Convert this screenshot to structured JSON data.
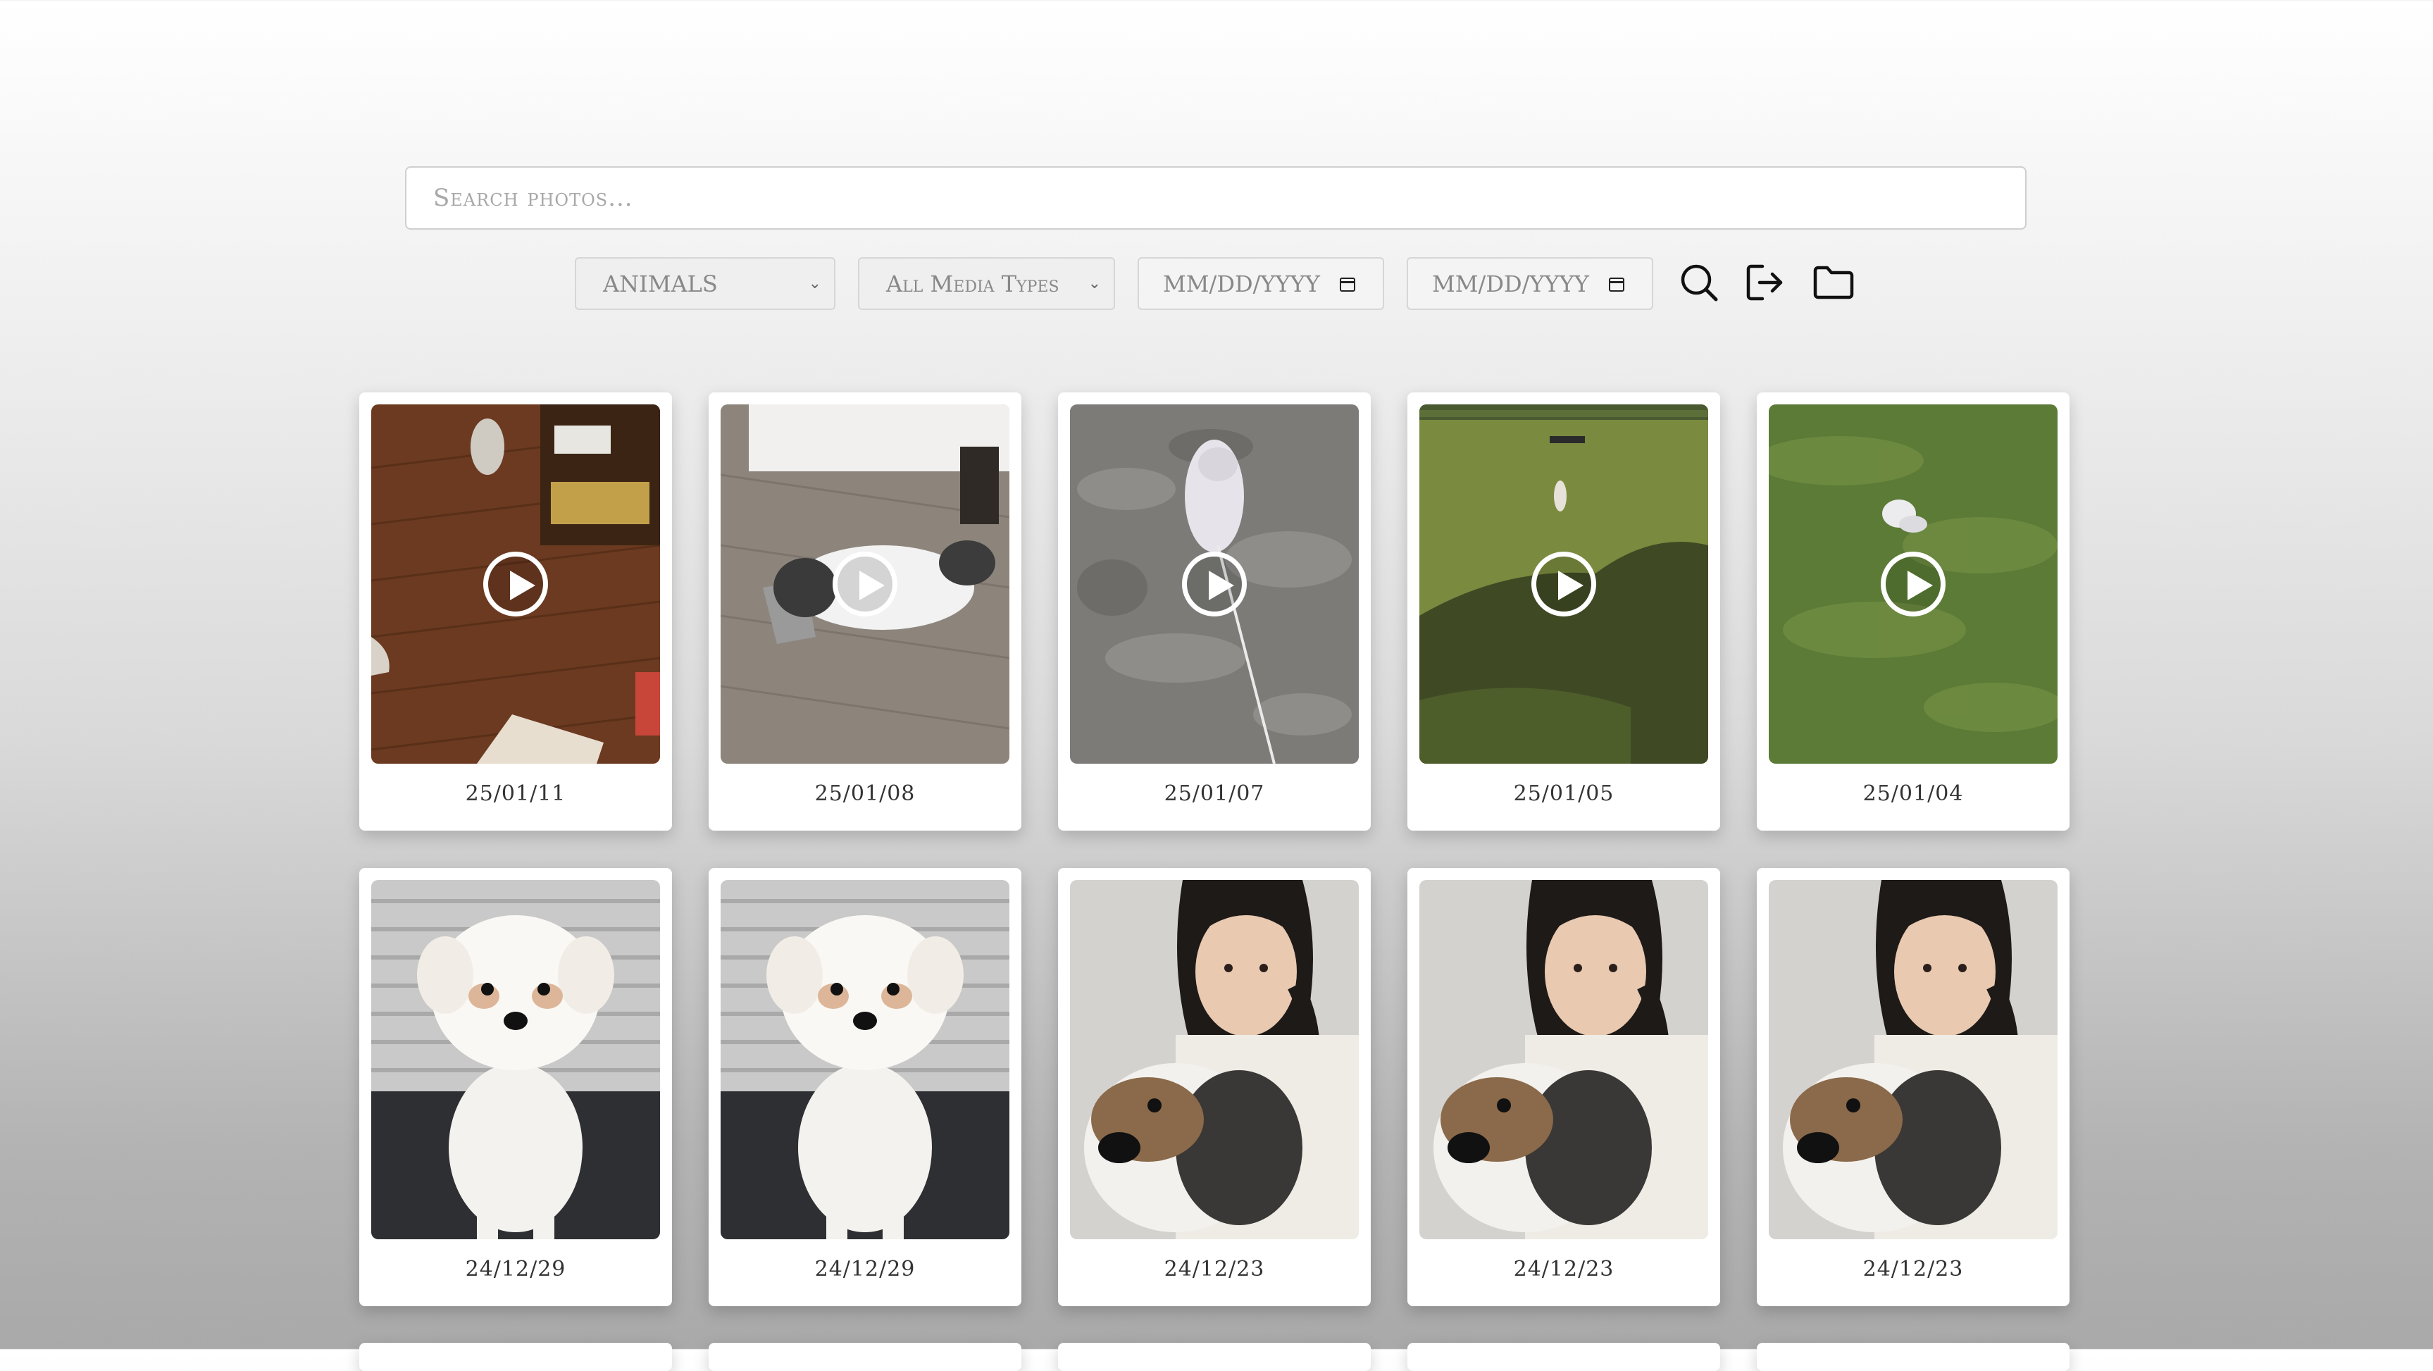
{
  "search": {
    "placeholder": "Search photos..."
  },
  "filters": {
    "category": "ANIMALS",
    "media_type": "All Media Types",
    "start_date": "MM/DD/YYYY",
    "end_date": "MM/DD/YYYY"
  },
  "toolbar": {
    "icons": [
      "search-icon",
      "logout-icon",
      "folder-icon"
    ]
  },
  "gallery": {
    "items": [
      {
        "date": "25/01/11",
        "is_video": true
      },
      {
        "date": "25/01/08",
        "is_video": true
      },
      {
        "date": "25/01/07",
        "is_video": true
      },
      {
        "date": "25/01/05",
        "is_video": true
      },
      {
        "date": "25/01/04",
        "is_video": true
      },
      {
        "date": "24/12/29",
        "is_video": false
      },
      {
        "date": "24/12/29",
        "is_video": false
      },
      {
        "date": "24/12/23",
        "is_video": false
      },
      {
        "date": "24/12/23",
        "is_video": false
      },
      {
        "date": "24/12/23",
        "is_video": false
      }
    ]
  }
}
